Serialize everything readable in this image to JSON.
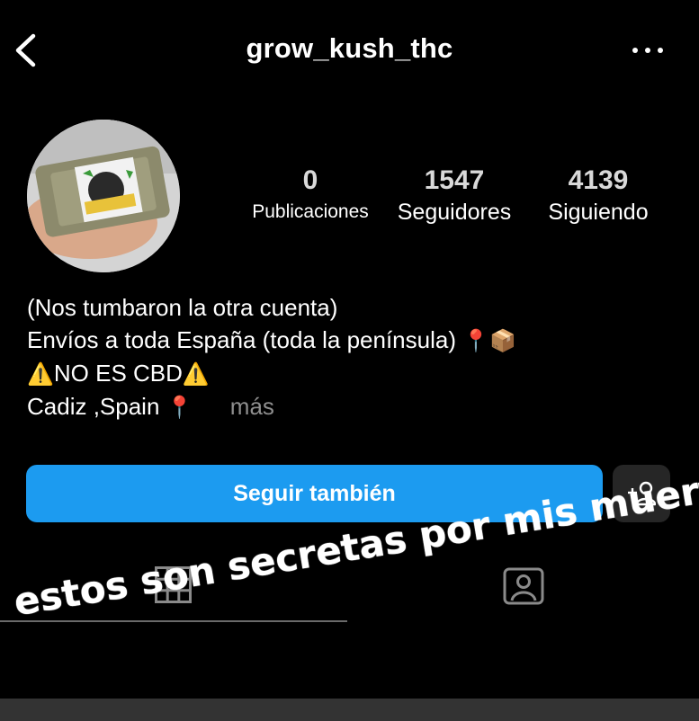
{
  "header": {
    "username": "grow_kush_thc"
  },
  "stats": {
    "posts": {
      "value": "0",
      "label": "Publicaciones"
    },
    "followers": {
      "value": "1547",
      "label": "Seguidores"
    },
    "following": {
      "value": "4139",
      "label": "Siguiendo"
    }
  },
  "bio": {
    "line1": "(Nos tumbaron la otra cuenta)",
    "line2": "Envíos a toda España (toda la península)",
    "line2_emojis": "📍📦",
    "line3_prefix_emoji": "⚠️",
    "line3_text": "NO ES CBD",
    "line3_suffix_emoji": "⚠️",
    "line4": "Cadiz ,Spain",
    "line4_emoji": "📍",
    "more_link": "más"
  },
  "actions": {
    "follow_label": "Seguir también"
  },
  "overlay": {
    "caption": "estos son secretas por mis muerto"
  },
  "colors": {
    "follow_button": "#1c9bf0",
    "background": "#000000",
    "secondary_text": "#8e8e8e"
  },
  "icons": {
    "back": "chevron-left-icon",
    "more": "more-horizontal-icon",
    "suggest": "add-person-icon",
    "grid_tab": "grid-icon",
    "tagged_tab": "tagged-person-icon"
  }
}
